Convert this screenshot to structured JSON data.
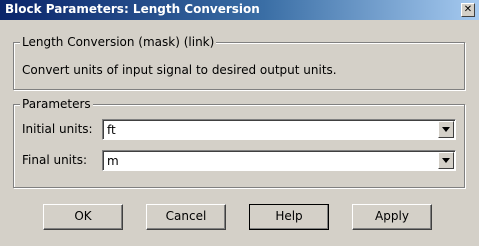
{
  "window": {
    "title": "Block Parameters: Length Conversion",
    "close_label": "✕"
  },
  "mask": {
    "legend": "Length Conversion (mask) (link)",
    "description": "Convert units of input signal to desired output units."
  },
  "parameters": {
    "legend": "Parameters",
    "initial_units_label": "Initial units:",
    "initial_units_value": "ft",
    "final_units_label": "Final units:",
    "final_units_value": "m"
  },
  "buttons": {
    "ok": "OK",
    "cancel": "Cancel",
    "help": "Help",
    "apply": "Apply"
  }
}
